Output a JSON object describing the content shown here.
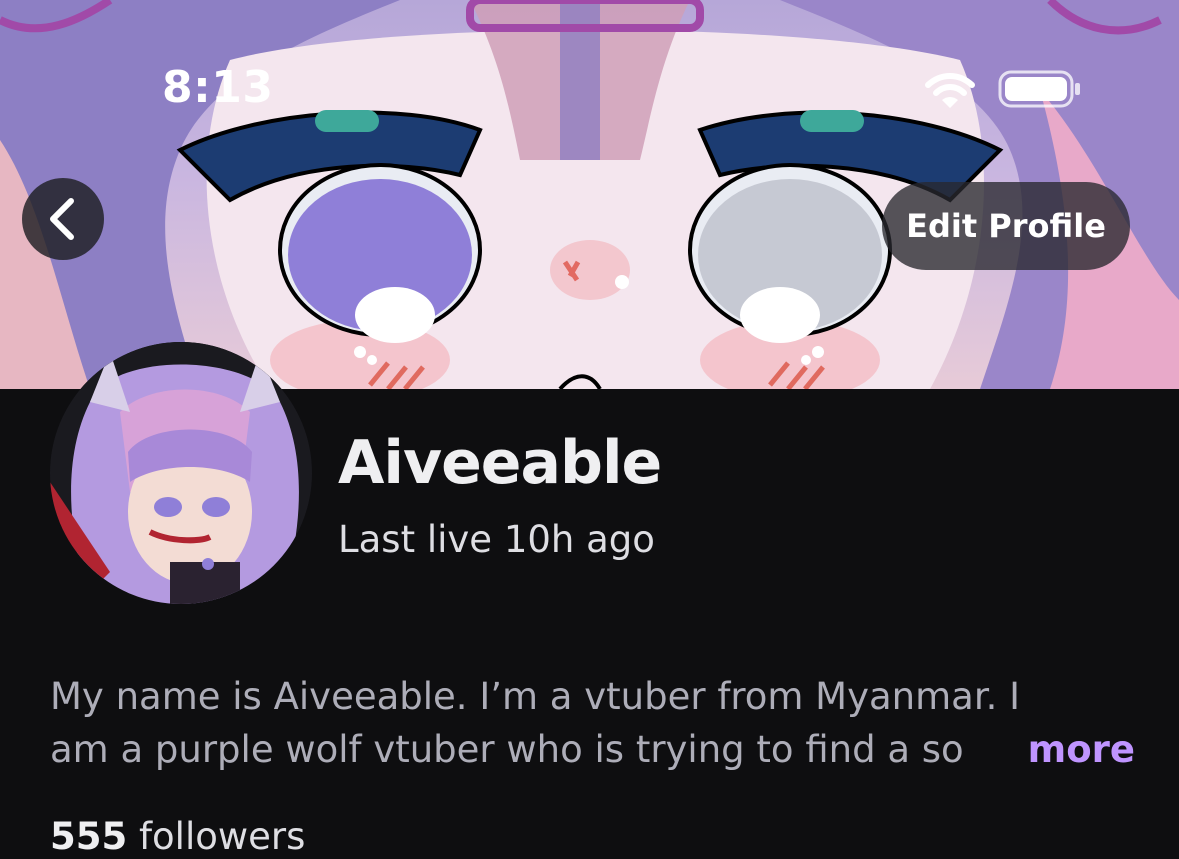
{
  "status_bar": {
    "time": "8:13",
    "icons": [
      "wifi-icon",
      "battery-icon"
    ]
  },
  "header": {
    "back_icon": "chevron-left-icon",
    "edit_profile_label": "Edit Profile"
  },
  "profile": {
    "channel_name": "Aiveeable",
    "last_live": "Last live 10h ago",
    "bio_line_1": "My name is Aiveeable. I’m a vtuber from Myanmar. I",
    "bio_line_2": "am a purple wolf vtuber who is trying to find a so",
    "bio_more": "more",
    "followers_count": "555",
    "followers_label": "followers"
  },
  "colors": {
    "background": "#0e0e10",
    "accent": "#bf94ff",
    "text_primary": "#efeff1",
    "text_secondary": "#adadb8"
  }
}
